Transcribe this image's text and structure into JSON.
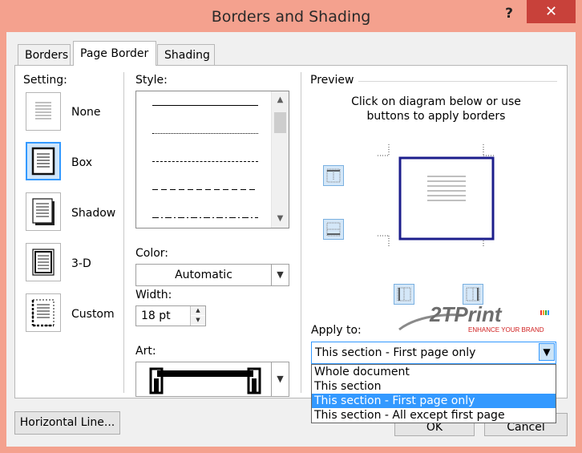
{
  "window": {
    "title": "Borders and Shading",
    "help_glyph": "?",
    "close_glyph": "✕"
  },
  "tabs": [
    {
      "label": "Borders",
      "active": false
    },
    {
      "label": "Page Border",
      "active": true
    },
    {
      "label": "Shading",
      "active": false
    }
  ],
  "setting": {
    "label": "Setting:",
    "options": [
      {
        "label": "None",
        "selected": false
      },
      {
        "label": "Box",
        "selected": true
      },
      {
        "label": "Shadow",
        "selected": false
      },
      {
        "label": "3-D",
        "selected": false
      },
      {
        "label": "Custom",
        "selected": false
      }
    ]
  },
  "style": {
    "label": "Style:",
    "line_styles": [
      "solid",
      "dotted",
      "dashed-short",
      "dashed-long",
      "dash-dot"
    ]
  },
  "color": {
    "label": "Color:",
    "value": "Automatic"
  },
  "width": {
    "label": "Width:",
    "value": "18 pt"
  },
  "art": {
    "label": "Art:"
  },
  "preview": {
    "label": "Preview",
    "instructions_line1": "Click on diagram below or use",
    "instructions_line2": "buttons to apply borders",
    "border_color": "#1c1e8c"
  },
  "apply_to": {
    "label": "Apply to:",
    "value": "This section - First page only",
    "options": [
      {
        "label": "Whole document",
        "selected": false
      },
      {
        "label": "This section",
        "selected": false
      },
      {
        "label": "This section - First page only",
        "selected": true
      },
      {
        "label": "This section - All except first page",
        "selected": false
      }
    ]
  },
  "logo": {
    "brand": "2TPrint",
    "tagline": "ENHANCE YOUR BRAND"
  },
  "buttons": {
    "horizontal_line": "Horizontal Line...",
    "ok": "OK",
    "cancel": "Cancel"
  },
  "colors": {
    "titlebar": "#f4a18e",
    "close": "#c8413a",
    "selection": "#3399ff"
  }
}
